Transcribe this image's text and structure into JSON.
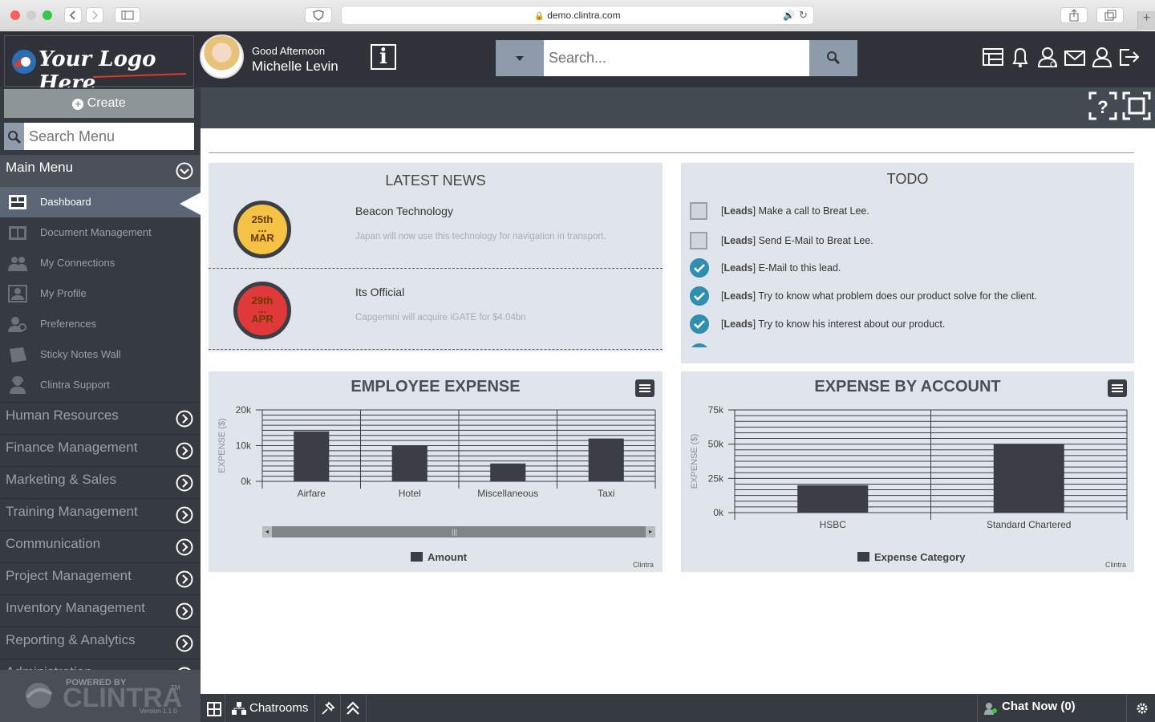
{
  "browser": {
    "url": "demo.clintra.com"
  },
  "header": {
    "logo_text": "Your Logo Here",
    "greeting": "Good Afternoon",
    "user_name": "Michelle Levin",
    "info_label": "i",
    "search_placeholder": "Search..."
  },
  "sidebar": {
    "create_label": "Create",
    "search_placeholder": "Search Menu",
    "main_menu_label": "Main Menu",
    "sub_items": [
      {
        "label": "Dashboard",
        "icon": "dashboard-icon"
      },
      {
        "label": "Document Management",
        "icon": "document-icon"
      },
      {
        "label": "My Connections",
        "icon": "connections-icon"
      },
      {
        "label": "My Profile",
        "icon": "profile-icon"
      },
      {
        "label": "Preferences",
        "icon": "preferences-icon"
      },
      {
        "label": "Sticky Notes Wall",
        "icon": "sticky-notes-icon"
      },
      {
        "label": "Clintra Support",
        "icon": "support-icon"
      }
    ],
    "sections": [
      "Human Resources",
      "Finance Management",
      "Marketing & Sales",
      "Training Management",
      "Communication",
      "Project Management",
      "Inventory Management",
      "Reporting & Analytics",
      "Administration"
    ],
    "powered_by": "POWERED BY",
    "brand": "CLINTRA",
    "tm": "TM",
    "version": "Version 1.1.0"
  },
  "news": {
    "title": "LATEST NEWS",
    "items": [
      {
        "day": "25th",
        "dots": "...",
        "month": "MAR",
        "headline": "Beacon Technology",
        "summary": "Japan will now use this technology for navigation in transport.",
        "color": "#f6c244"
      },
      {
        "day": "29th",
        "dots": "...",
        "month": "APR",
        "headline": "Its Official",
        "summary": "Capgemini will acquire iGATE for $4.04bn",
        "color": "#e1393a"
      }
    ]
  },
  "todo": {
    "title": "TODO",
    "items": [
      {
        "tag": "Leads",
        "text": "Make a call to Breat Lee.",
        "done": false
      },
      {
        "tag": "Leads",
        "text": "Send E-Mail to Breat Lee.",
        "done": false
      },
      {
        "tag": "Leads",
        "text": "E-Mail to this lead.",
        "done": true
      },
      {
        "tag": "Leads",
        "text": "Try to know what problem does our product solve for the client.",
        "done": true
      },
      {
        "tag": "Leads",
        "text": "Try to know his interest about our product.",
        "done": true
      }
    ]
  },
  "chart_data": [
    {
      "type": "bar",
      "title": "EMPLOYEE EXPENSE",
      "ylabel": "EXPENSE ($)",
      "categories": [
        "Airfare",
        "Hotel",
        "Miscellaneous",
        "Taxi"
      ],
      "series": [
        {
          "name": "Amount",
          "values": [
            14000,
            10000,
            5000,
            12000
          ]
        }
      ],
      "yticks": [
        "20k",
        "10k",
        "0k"
      ],
      "ylim": [
        0,
        20000
      ],
      "credit": "Clintra",
      "grid": true,
      "legend": "bottom"
    },
    {
      "type": "bar",
      "title": "EXPENSE BY ACCOUNT",
      "ylabel": "EXPENSE ($)",
      "categories": [
        "HSBC",
        "Standard Chartered"
      ],
      "series": [
        {
          "name": "Expense Category",
          "values": [
            20000,
            50000
          ]
        }
      ],
      "yticks": [
        "75k",
        "50k",
        "25k",
        "0k"
      ],
      "ylim": [
        0,
        75000
      ],
      "credit": "Clintra",
      "grid": true,
      "legend": "bottom"
    }
  ],
  "footer": {
    "chatrooms_label": "Chatrooms",
    "chat_now_label": "Chat Now (0)"
  },
  "colors": {
    "accent": "#2e8fb0",
    "bar": "#3b3f45",
    "sidebar": "#363a41"
  }
}
